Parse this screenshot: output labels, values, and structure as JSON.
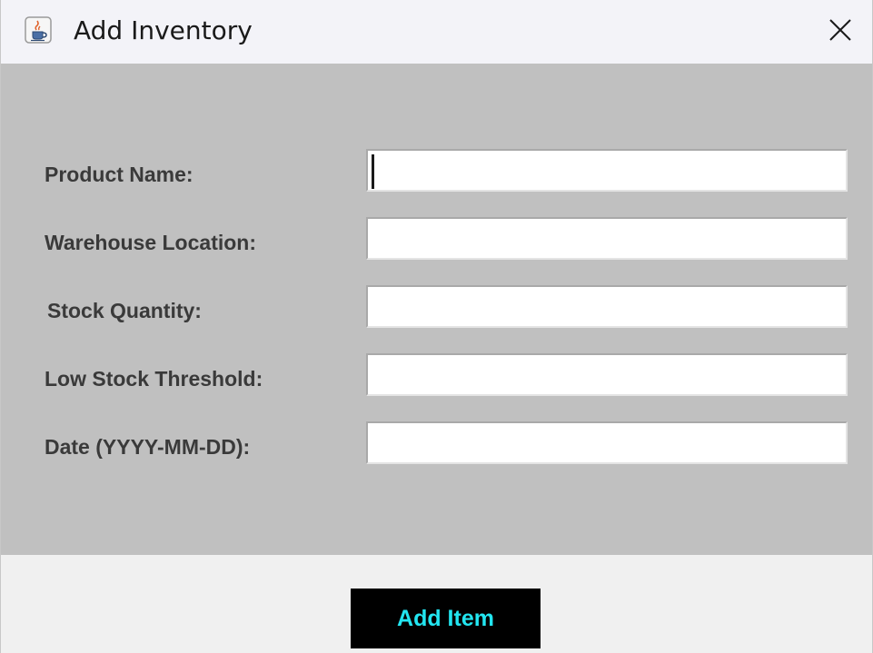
{
  "window": {
    "title": "Add Inventory",
    "app_icon": "java-cup-icon",
    "close_icon": "close-icon"
  },
  "form": {
    "fields": [
      {
        "label": "Product Name:",
        "value": "",
        "focused": true
      },
      {
        "label": "Warehouse Location:",
        "value": ""
      },
      {
        "label": "Stock Quantity:",
        "value": ""
      },
      {
        "label": "Low Stock Threshold:",
        "value": ""
      },
      {
        "label": "Date (YYYY-MM-DD):",
        "value": ""
      }
    ]
  },
  "actions": {
    "add_label": "Add Item"
  },
  "colors": {
    "form_background": "#c0c0c0",
    "button_background": "#000000",
    "button_text": "#22e5f0",
    "label_text": "#3a3a3a"
  }
}
